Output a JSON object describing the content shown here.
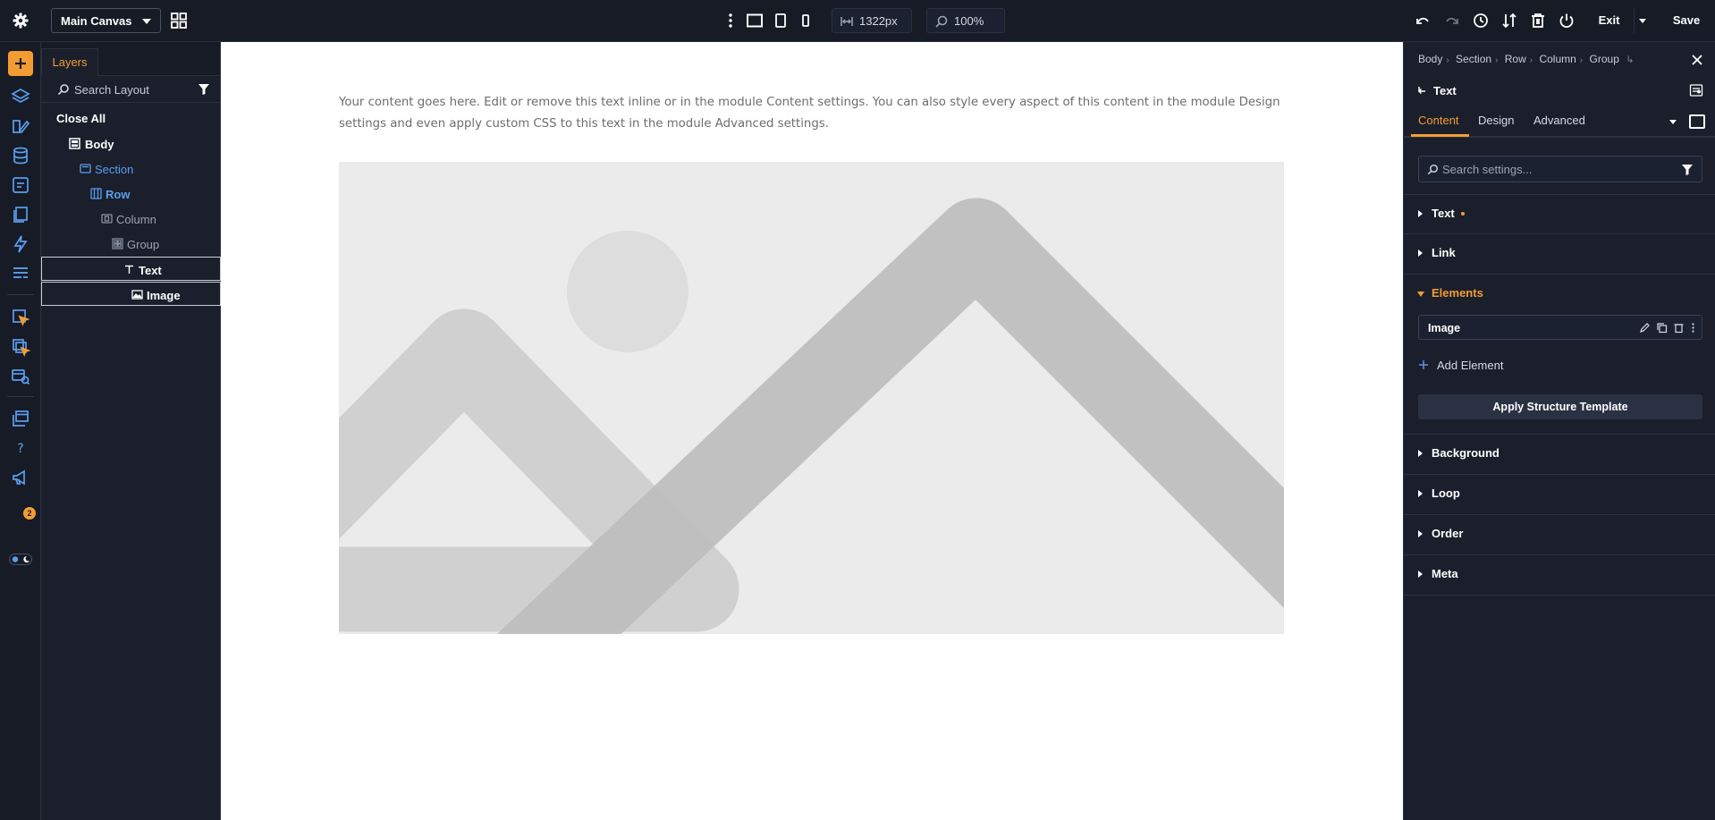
{
  "toolbar": {
    "canvas_name": "Main Canvas",
    "width_value": "1322px",
    "zoom_value": "100%",
    "exit_label": "Exit",
    "save_label": "Save"
  },
  "rail": {
    "notification_count": "2",
    "accent_color": "#f39c33",
    "icon_color": "#5b9ef0"
  },
  "layers": {
    "tab_label": "Layers",
    "search_label": "Search Layout",
    "close_all_label": "Close All",
    "items": [
      {
        "label": "Body",
        "icon": "body-icon"
      },
      {
        "label": "Section",
        "icon": "section-icon"
      },
      {
        "label": "Row",
        "icon": "row-icon"
      },
      {
        "label": "Column",
        "icon": "column-icon"
      },
      {
        "label": "Group",
        "icon": "group-icon"
      },
      {
        "label": "Text",
        "icon": "text-icon"
      },
      {
        "label": "Image",
        "icon": "image-icon"
      }
    ]
  },
  "canvas": {
    "body_text": "Your content goes here. Edit or remove this text inline or in the module Content settings. You can also style every aspect of this content in the module Design settings and even apply custom CSS to this text in the module Advanced settings."
  },
  "settings": {
    "breadcrumb": [
      "Body",
      "Section",
      "Row",
      "Column",
      "Group"
    ],
    "module_title": "Text",
    "tabs": [
      "Content",
      "Design",
      "Advanced"
    ],
    "search_placeholder": "Search settings...",
    "sections": {
      "text": "Text",
      "link": "Link",
      "elements": "Elements",
      "background": "Background",
      "loop": "Loop",
      "order": "Order",
      "meta": "Meta"
    },
    "element_item": "Image",
    "add_element_label": "Add Element",
    "apply_template_label": "Apply Structure Template"
  }
}
